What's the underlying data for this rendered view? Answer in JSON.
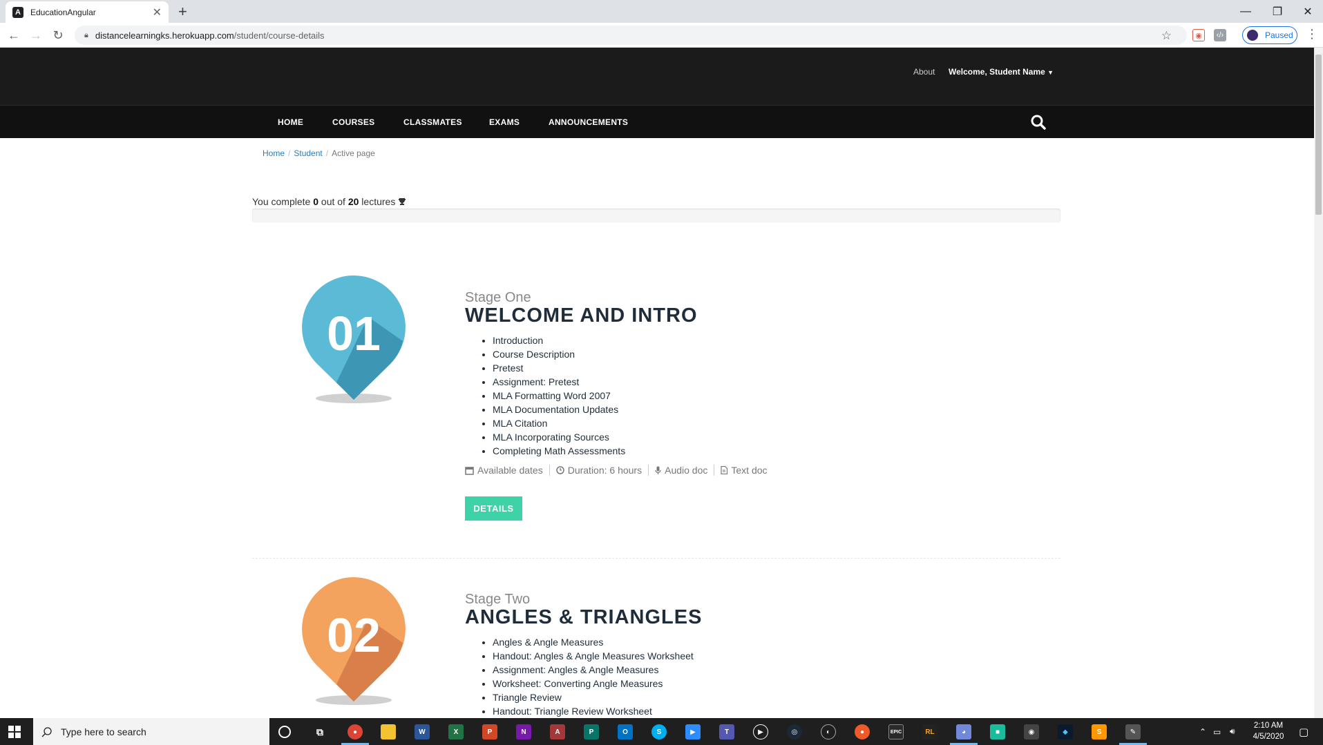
{
  "browser": {
    "tab_title": "EducationAngular",
    "url_host": "distancelearningks.herokuapp.com",
    "url_path": "/student/course-details",
    "profile_status": "Paused"
  },
  "header": {
    "about": "About",
    "welcome": "Welcome, Student Name"
  },
  "nav": {
    "items": [
      "HOME",
      "COURSES",
      "CLASSMATES",
      "EXAMS",
      "ANNOUNCEMENTS"
    ]
  },
  "breadcrumb": {
    "home": "Home",
    "student": "Student",
    "active": "Active page"
  },
  "progress": {
    "prefix": "You complete",
    "completed": "0",
    "middle": "out of",
    "total": "20",
    "suffix": "lectures",
    "fraction": 0
  },
  "stages": [
    {
      "number": "01",
      "subtitle": "Stage One",
      "title": "WELCOME AND INTRO",
      "color_main": "#5bbad5",
      "color_shade": "#3c96b4",
      "lectures": [
        "Introduction",
        "Course Description",
        "Pretest",
        "Assignment: Pretest",
        "MLA Formatting Word 2007",
        "MLA Documentation Updates",
        "MLA Citation",
        "MLA Incorporating Sources",
        "Completing Math Assessments"
      ],
      "meta": {
        "dates": "Available dates",
        "duration": "Duration: 6 hours",
        "audio": "Audio doc",
        "text": "Text doc"
      },
      "button": "DETAILS"
    },
    {
      "number": "02",
      "subtitle": "Stage Two",
      "title": "ANGLES & TRIANGLES",
      "color_main": "#f4a35e",
      "color_shade": "#d9804a",
      "lectures": [
        "Angles & Angle Measures",
        "Handout: Angles & Angle Measures Worksheet",
        "Assignment: Angles & Angle Measures",
        "Worksheet: Converting Angle Measures",
        "Triangle Review",
        "Handout: Triangle Review Worksheet"
      ]
    }
  ],
  "taskbar": {
    "search_placeholder": "Type here to search",
    "time": "2:10 AM",
    "date": "4/5/2020"
  }
}
